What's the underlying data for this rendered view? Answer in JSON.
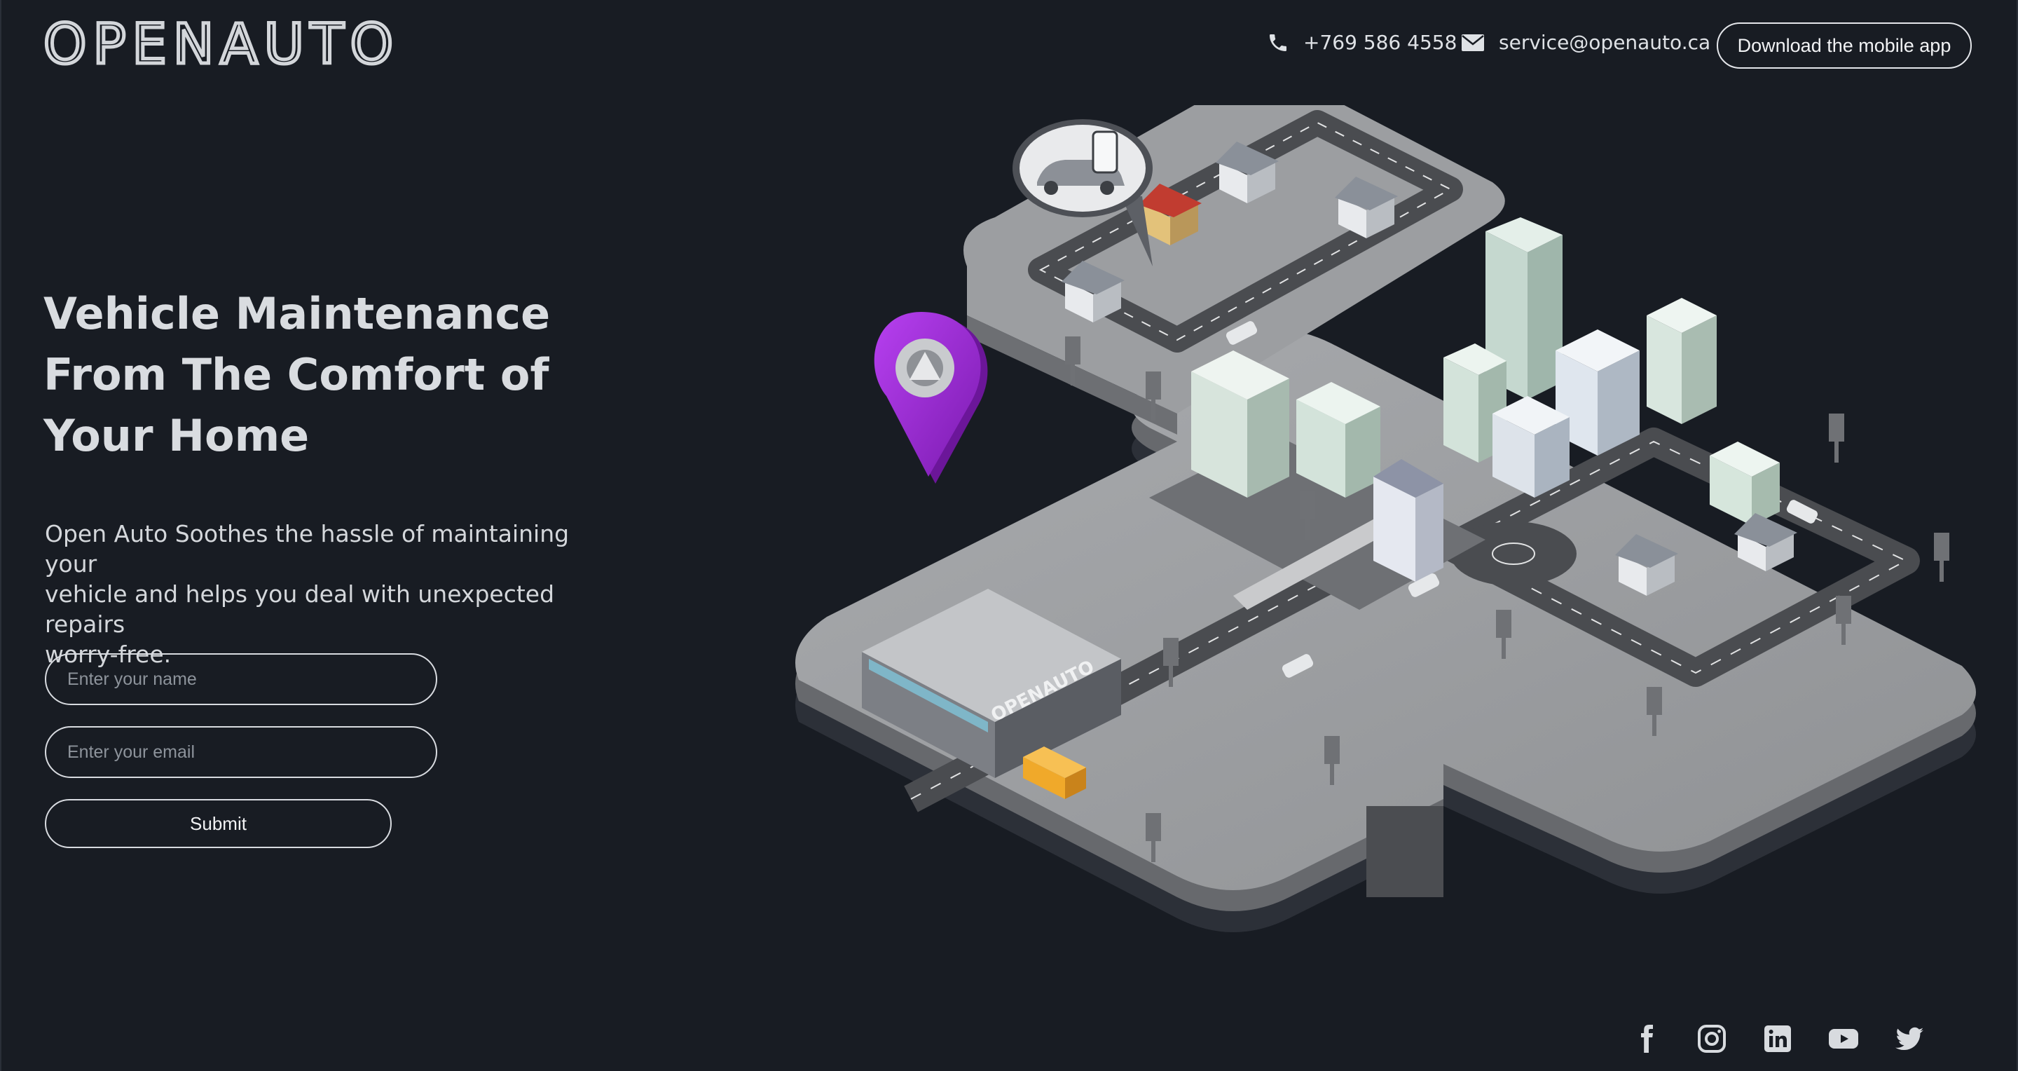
{
  "header": {
    "brand": "OPENAUTO",
    "phone": "+769 586 4558",
    "email": "service@openauto.ca",
    "app_button": "Download the mobile app"
  },
  "hero": {
    "headline_lines": [
      "Vehicle Maintenance",
      "From The Comfort of",
      "Your Home"
    ],
    "description_lines": [
      "Open Auto Soothes the hassle of maintaining your",
      "vehicle and helps you deal with unexpected repairs",
      "worry-free."
    ]
  },
  "form": {
    "name_placeholder": "Enter your name",
    "name_value": "",
    "email_placeholder": "Enter your email",
    "email_value": "",
    "submit_label": "Submit"
  },
  "illustration": {
    "building_sign": "OPENAUTO",
    "pin_color": "#9b2bd6"
  },
  "social": {
    "icons": [
      "facebook-icon",
      "instagram-icon",
      "linkedin-icon",
      "youtube-icon",
      "twitter-icon"
    ]
  },
  "colors": {
    "background": "#181c23",
    "text": "#e6e8eb",
    "accent_pin": "#9b2bd6",
    "van": "#f0a92a"
  }
}
